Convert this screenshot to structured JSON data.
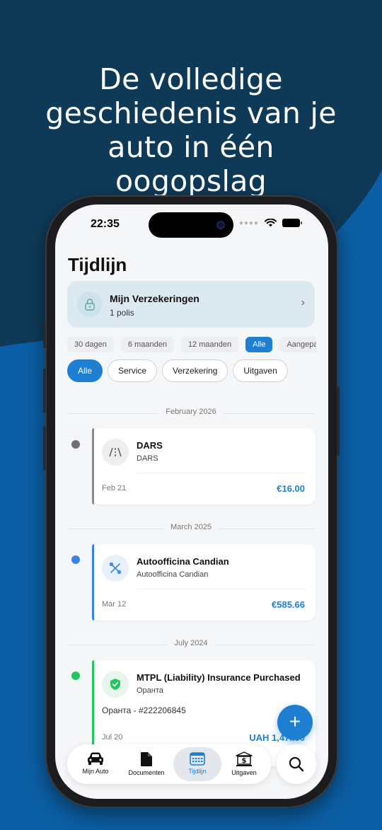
{
  "colors": {
    "background": "#0e3a58",
    "wave": "#0b5fa5",
    "accent": "#1f7fd1",
    "dot_grey": "#6f6f74",
    "dot_blue": "#3b82e6",
    "dot_green": "#22c55e"
  },
  "headline": {
    "line1": "De volledige",
    "line2": "geschiedenis van je",
    "line3": "auto in één",
    "line4": "oogopslag"
  },
  "status_bar": {
    "time": "22:35",
    "signal_icon": "signal-dots-icon",
    "wifi_icon": "wifi-icon",
    "battery_icon": "battery-icon"
  },
  "page": {
    "title": "Tijdlijn"
  },
  "insurance_card": {
    "icon": "lock-icon",
    "title": "Mijn Verzekeringen",
    "subtitle": "1 polis",
    "chevron_icon": "chevron-right-icon",
    "chevron": "›"
  },
  "periods": [
    {
      "label": "30 dagen",
      "active": false
    },
    {
      "label": "6 maanden",
      "active": false
    },
    {
      "label": "12 maanden",
      "active": false
    },
    {
      "label": "Alle",
      "active": true
    },
    {
      "label": "Aangepast",
      "active": false
    }
  ],
  "filters": [
    {
      "label": "Alle",
      "active": true
    },
    {
      "label": "Service",
      "active": false
    },
    {
      "label": "Verzekering",
      "active": false
    },
    {
      "label": "Uitgaven",
      "active": false
    }
  ],
  "timeline": [
    {
      "month": "February 2026",
      "event": {
        "icon": "road-icon",
        "title": "DARS",
        "subtitle": "DARS",
        "date": "Feb 21",
        "amount": "€16.00"
      }
    },
    {
      "month": "March 2025",
      "event": {
        "icon": "tools-icon",
        "title": "Autoofficina Candian",
        "subtitle": "Autoofficina Candian",
        "date": "Mar 12",
        "amount": "€585.66"
      }
    },
    {
      "month": "July 2024",
      "event": {
        "icon": "shield-check-icon",
        "title": "MTPL (Liability) Insurance Purchased",
        "subtitle": "Оранта",
        "note": "Оранта - #222206845",
        "date": "Jul 20",
        "amount": "UAH 1,47..00"
      }
    }
  ],
  "fab": {
    "icon": "plus-icon",
    "label": "+"
  },
  "tabbar": {
    "tabs": [
      {
        "label": "Mijn Auto",
        "icon": "car-icon",
        "active": false
      },
      {
        "label": "Documenten",
        "icon": "document-icon",
        "active": false
      },
      {
        "label": "Tijdlijn",
        "icon": "calendar-icon",
        "active": true
      },
      {
        "label": "Uitgaven",
        "icon": "bank-dollar-icon",
        "active": false
      }
    ],
    "search_icon": "search-icon"
  }
}
